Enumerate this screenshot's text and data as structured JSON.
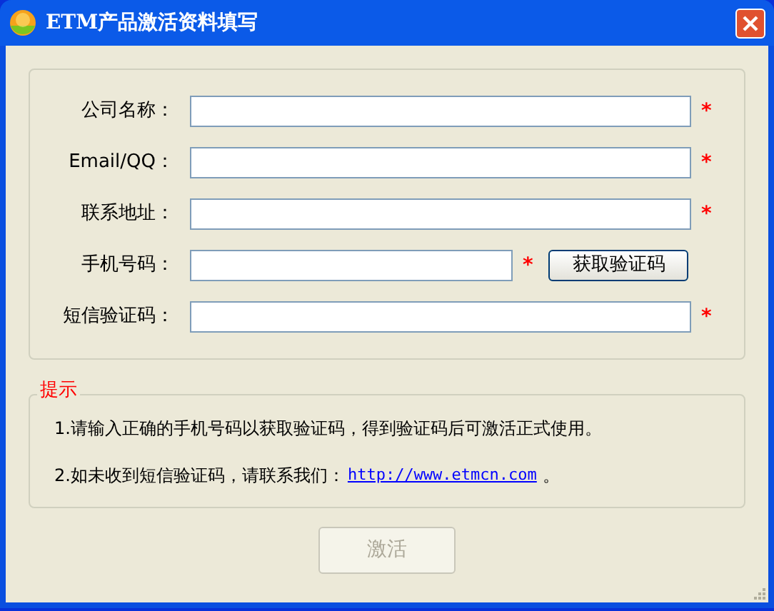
{
  "window": {
    "title": "ETM产品激活资料填写"
  },
  "fields": [
    {
      "label": "公司名称：",
      "required": true,
      "kind": "text"
    },
    {
      "label": "Email/QQ：",
      "required": true,
      "kind": "text"
    },
    {
      "label": "联系地址：",
      "required": true,
      "kind": "text"
    },
    {
      "label": "手机号码：",
      "required": true,
      "kind": "phone",
      "button": "获取验证码"
    },
    {
      "label": "短信验证码：",
      "required": true,
      "kind": "text"
    }
  ],
  "required_mark": "*",
  "hints": {
    "title": "提示",
    "lines": [
      {
        "text": "1.请输入正确的手机号码以获取验证码，得到验证码后可激活正式使用。"
      },
      {
        "text": "2.如未收到短信验证码，请联系我们：",
        "link": "http://www.etmcn.com",
        "suffix": "。"
      }
    ]
  },
  "submit": {
    "label": "激活",
    "disabled": true
  }
}
